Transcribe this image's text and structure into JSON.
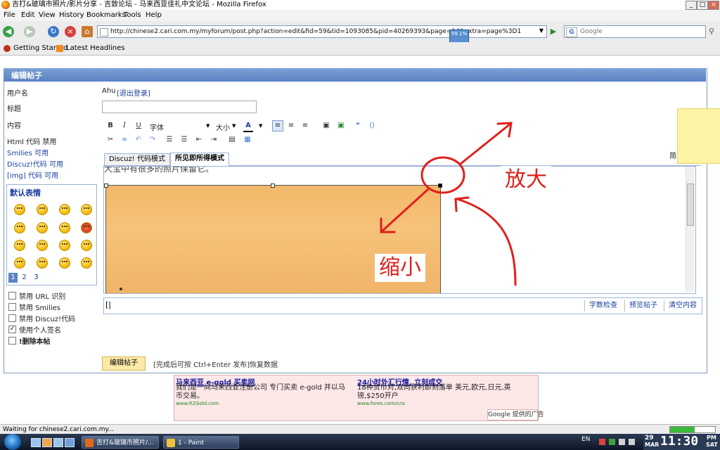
{
  "window": {
    "title": "吉打&玻璃市照片/影片分享 - 吉致论坛 - 马来西亚佳礼中文论坛 - Mozilla Firefox"
  },
  "menu": [
    "File",
    "Edit",
    "View",
    "History",
    "Bookmarks",
    "Tools",
    "Help"
  ],
  "nav": {
    "url": "http://chinese2.cari.com.my/myforum/post.php?action=edit&fid=59&tid=1093085&pid=40269393&page=14&extra=page%3D1",
    "search_placeholder": "Google",
    "progress_popup": "59.1%"
  },
  "bookmarks": [
    "Getting Started",
    "Latest Headlines"
  ],
  "form": {
    "heading": "编辑帖子",
    "username_label": "用户名",
    "username_value": "Ahu",
    "logout_link": "[退出登录]",
    "subject_label": "标题",
    "content_label": "内容",
    "info_lines": [
      "Html 代码 禁用",
      "Smilies 可用",
      "Discuz!代码 可用",
      "[img] 代码 可用"
    ],
    "smilies_title": "默认表情",
    "smiley_pages": [
      "1",
      "2",
      "3"
    ],
    "options": [
      {
        "label": "禁用 URL 识别",
        "checked": false
      },
      {
        "label": "禁用 Smilies",
        "checked": false
      },
      {
        "label": "禁用 Discuz!代码",
        "checked": false
      },
      {
        "label": "使用个人签名",
        "checked": true
      },
      {
        "label": "!删除本帖",
        "checked": false
      }
    ]
  },
  "editor": {
    "toolbar": {
      "bold": "B",
      "italic": "I",
      "underline": "U",
      "font_label": "字体",
      "size_label": "大小",
      "color": "A"
    },
    "simplified_toggle": "简",
    "tabs": [
      "Discuz! 代码模式",
      "所见即所得模式"
    ],
    "active_tab": 1,
    "body_text": "大宝中有很多的照片保留它。",
    "image_fill_color": "#f6c27a",
    "status_buttons": [
      "字数检查",
      "预览帖子",
      "清空内容"
    ]
  },
  "annotations": {
    "enlarge": "放大",
    "shrink": "缩小",
    "color": "#e0201b"
  },
  "actions": {
    "submit": "编辑帖子",
    "hint": "[完成后可按 Ctrl+Enter 发布]",
    "restore": "恢复数据"
  },
  "ad": {
    "left_title": "马来西亚 e-gold 买卖网",
    "left_body": "我们是一间马来西亚注册公司 专门买卖 e-gold 并以马币交易。",
    "left_url": "www.R2Gold.com",
    "right_title": "24小时外汇行情, 立刻成交",
    "right_body": "18种货币对,双向获利即刻落单 美元,欧元,日元,英镑,$250开户",
    "right_url": "www.forex.com/cns",
    "badge": "Google 提供的广告"
  },
  "status": {
    "text": "Waiting for chinese2.cari.com.my...",
    "load_progress": 0.55
  },
  "taskbar": {
    "tasks": [
      "吉打&玻璃市照片/...",
      "1 - Paint"
    ],
    "lang": "EN",
    "date_day": "29",
    "date_month": "MAR",
    "time": "11:30",
    "ampm": "PM",
    "weekday": "SAT"
  },
  "colors": {
    "panel_header": "#5a82c2",
    "link_blue": "#1a3fa0",
    "submit_bg": "#fde9a8"
  }
}
